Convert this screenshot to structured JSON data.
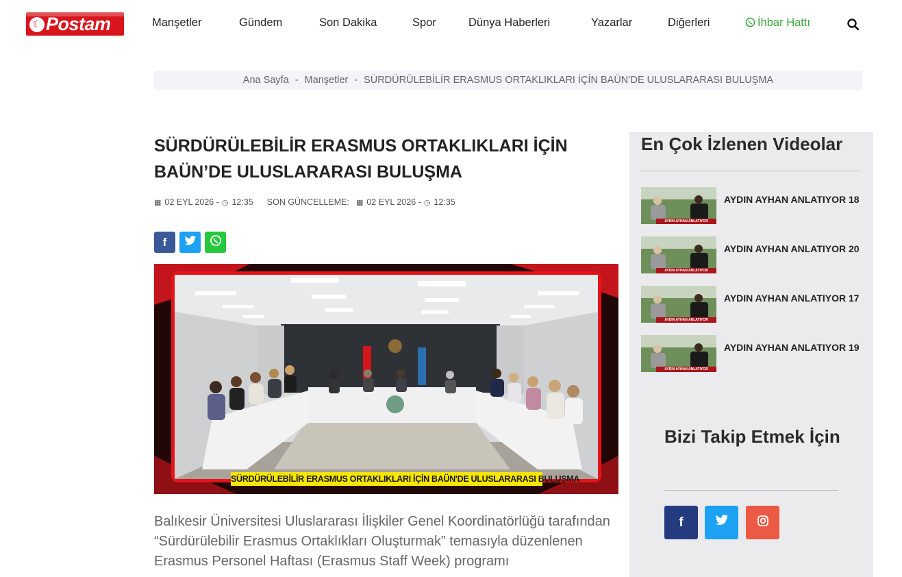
{
  "header": {
    "logo_text": "Postam",
    "nav": [
      {
        "label": "Manşetler"
      },
      {
        "label": "Gündem"
      },
      {
        "label": "Son Dakika"
      },
      {
        "label": "Spor"
      },
      {
        "label": "Dünya Haberleri"
      },
      {
        "label": "Yazarlar"
      },
      {
        "label": "Diğerleri"
      },
      {
        "label": "İhbar Hattı"
      }
    ],
    "search_icon": "search-icon"
  },
  "breadcrumb": {
    "home": "Ana Sayfa",
    "section": "Manşetler",
    "current": "SÜRDÜRÜLEBİLİR ERASMUS ORTAKLIKLARI İÇİN BAÜN’DE ULUSLARARASI BULUŞMA",
    "separator": "-"
  },
  "article": {
    "title": "SÜRDÜRÜLEBİLİR ERASMUS ORTAKLIKLARI İÇİN BAÜN’DE ULUSLARARASI BULUŞMA",
    "published_date": "02 EYL 2026 -",
    "published_time": "12:35",
    "updated_label": "SON GÜNCELLEME:",
    "updated_date": "02 EYL 2026 -",
    "updated_time": "12:35",
    "image_caption": "SÜRDÜRÜLEBİLİR ERASMUS ORTAKLIKLARI İÇİN BAÜN'DE ULUSLARARASI BULUŞMA",
    "body": "Balıkesir Üniversitesi Uluslararası İlişkiler Genel Koordinatörlüğü tarafından “Sürdürülebilir Erasmus Ortaklıkları Oluşturmak” temasıyla düzenlenen Erasmus Personel Haftası (Erasmus Staff Week) programı"
  },
  "share": {
    "facebook": "f",
    "twitter": "t",
    "whatsapp": "w"
  },
  "sidebar": {
    "videos_title": "En Çok İzlenen Videolar",
    "videos": [
      {
        "title": "AYDIN AYHAN ANLATIYOR 18",
        "thumb_label": "AYDIN AYHAN ANLATIYOR"
      },
      {
        "title": "AYDIN AYHAN ANLATIYOR 20",
        "thumb_label": "AYDIN AYHAN ANLATIYOR"
      },
      {
        "title": "AYDIN AYHAN ANLATIYOR 17",
        "thumb_label": "AYDIN AYHAN ANLATIYOR"
      },
      {
        "title": "AYDIN AYHAN ANLATIYOR 19",
        "thumb_label": "AYDIN AYHAN ANLATIYOR"
      }
    ],
    "follow_title": "Bizi Takip Etmek İçin"
  },
  "colors": {
    "brand_red": "#d8141c",
    "whatsapp_green": "#3aa83a",
    "facebook": "#3b5998",
    "twitter": "#1da1f2",
    "instagram": "#ec5a45"
  }
}
